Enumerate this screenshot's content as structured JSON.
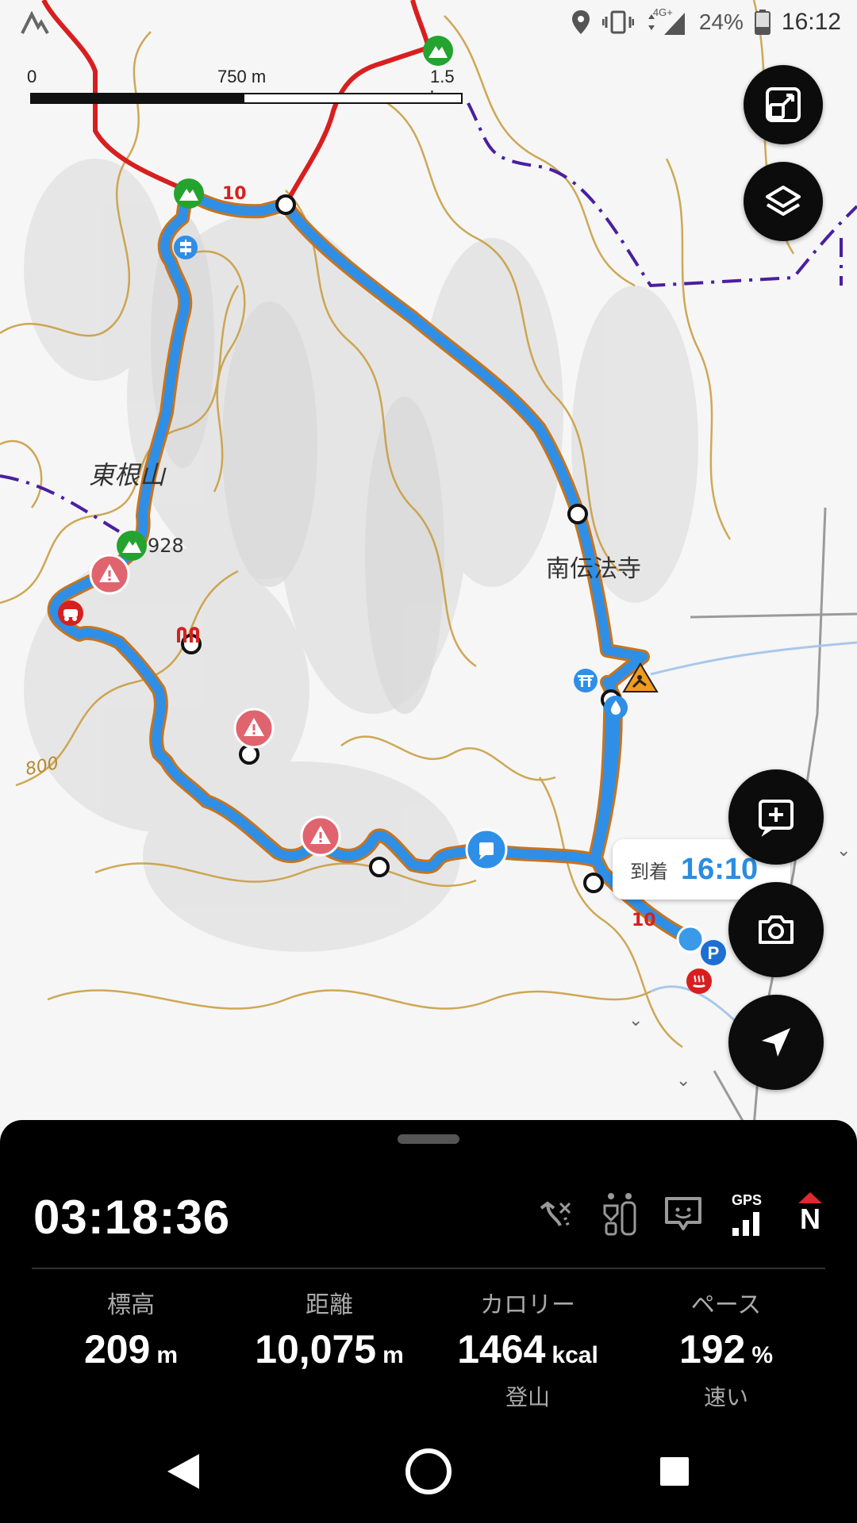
{
  "status": {
    "battery": "24%",
    "time": "16:12",
    "network": "4G+"
  },
  "scale": {
    "start": "0",
    "mid": "750 m",
    "end": "1.5 km"
  },
  "map": {
    "labels": {
      "peak_name": "東根山",
      "elevation_mark": "928",
      "temple": "南伝法寺",
      "contour": "800"
    },
    "route_marker": "10",
    "route_marker_end": "10",
    "arrival_label": "到着",
    "arrival_time": "16:10"
  },
  "colors": {
    "route": "#2f8fe6",
    "route_outline": "#c8741c",
    "trail_red": "#d81f1f",
    "boundary": "#4b1ea0",
    "contour": "#c89a3a",
    "fab": "#0c0c0c"
  },
  "fab_icons": [
    "fit-map-icon",
    "layers-icon",
    "add-note-icon",
    "camera-icon",
    "locate-icon"
  ],
  "panel": {
    "elapsed": "03:18:36",
    "gps_label": "GPS",
    "compass_label": "N",
    "stats": [
      {
        "label": "標高",
        "value": "209",
        "unit": "m",
        "sub": ""
      },
      {
        "label": "距離",
        "value": "10,075",
        "unit": "m",
        "sub": ""
      },
      {
        "label": "カロリー",
        "value": "1464",
        "unit": "kcal",
        "sub": "登山"
      },
      {
        "label": "ペース",
        "value": "192",
        "unit": "%",
        "sub": "速い"
      }
    ]
  }
}
